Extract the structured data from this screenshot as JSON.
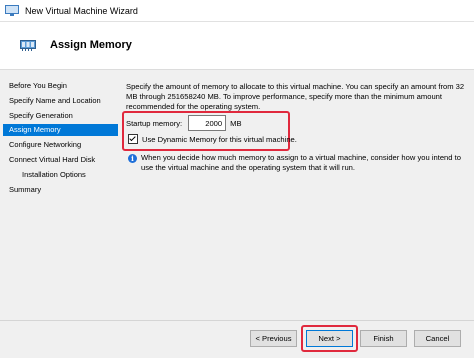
{
  "window": {
    "title": "New Virtual Machine Wizard",
    "icon": "hyper-v-window-icon"
  },
  "header": {
    "title": "Assign Memory",
    "icon": "memory-chip-icon"
  },
  "sidebar": {
    "items": [
      {
        "label": "Before You Begin"
      },
      {
        "label": "Specify Name and Location"
      },
      {
        "label": "Specify Generation"
      },
      {
        "label": "Assign Memory",
        "active": true
      },
      {
        "label": "Configure Networking"
      },
      {
        "label": "Connect Virtual Hard Disk"
      },
      {
        "label": "Installation Options",
        "indent": true
      },
      {
        "label": "Summary"
      }
    ]
  },
  "main": {
    "description": "Specify the amount of memory to allocate to this virtual machine. You can specify an amount from 32 MB through 251658240 MB. To improve performance, specify more than the minimum amount recommended for the operating system.",
    "startup_memory": {
      "label": "Startup memory:",
      "value": "2000",
      "unit": "MB"
    },
    "dynamic_memory": {
      "label": "Use Dynamic Memory for this virtual machine.",
      "checked": true
    },
    "info": {
      "icon": "info-icon",
      "text": "When you decide how much memory to assign to a virtual machine, consider how you intend to use the virtual machine and the operating system that it will run."
    }
  },
  "buttons": {
    "previous": "< Previous",
    "next": "Next >",
    "finish": "Finish",
    "cancel": "Cancel"
  },
  "colors": {
    "selection": "#0078d7",
    "annotation": "#e0293d",
    "info": "#1e6fd9"
  }
}
